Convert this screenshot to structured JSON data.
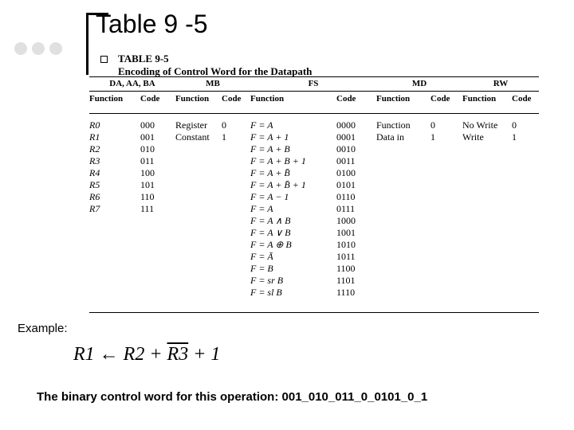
{
  "title": "Table 9 -5",
  "caption": {
    "num": "TABLE 9-5",
    "sub": "Encoding of Control Word for the Datapath"
  },
  "groups": {
    "da": "DA, AA, BA",
    "mb": "MB",
    "fs": "FS",
    "md": "MD",
    "rw": "RW"
  },
  "subheads": {
    "fn": "Function",
    "code": "Code"
  },
  "rows": {
    "da": [
      {
        "f": "R0",
        "c": "000"
      },
      {
        "f": "R1",
        "c": "001"
      },
      {
        "f": "R2",
        "c": "010"
      },
      {
        "f": "R3",
        "c": "011"
      },
      {
        "f": "R4",
        "c": "100"
      },
      {
        "f": "R5",
        "c": "101"
      },
      {
        "f": "R6",
        "c": "110"
      },
      {
        "f": "R7",
        "c": "111"
      }
    ],
    "mb": [
      {
        "f": "Register",
        "c": "0"
      },
      {
        "f": "Constant",
        "c": "1"
      }
    ],
    "fs": [
      {
        "f": "F = A",
        "c": "0000"
      },
      {
        "f": "F = A + 1",
        "c": "0001"
      },
      {
        "f": "F = A + B",
        "c": "0010"
      },
      {
        "f": "F = A + B + 1",
        "c": "0011"
      },
      {
        "f": "F = A + B̄",
        "c": "0100"
      },
      {
        "f": "F = A + B̄ + 1",
        "c": "0101"
      },
      {
        "f": "F = A − 1",
        "c": "0110"
      },
      {
        "f": "F = A",
        "c": "0111"
      },
      {
        "f": "F = A ∧ B",
        "c": "1000"
      },
      {
        "f": "F = A ∨ B",
        "c": "1001"
      },
      {
        "f": "F = A ⊕ B",
        "c": "1010"
      },
      {
        "f": "F = Ā",
        "c": "1011"
      },
      {
        "f": "F = B",
        "c": "1100"
      },
      {
        "f": "F = sr B",
        "c": "1101"
      },
      {
        "f": "F = sl B",
        "c": "1110"
      }
    ],
    "md": [
      {
        "f": "Function",
        "c": "0"
      },
      {
        "f": "Data in",
        "c": "1"
      }
    ],
    "rw": [
      {
        "f": "No Write",
        "c": "0"
      },
      {
        "f": "Write",
        "c": "1"
      }
    ]
  },
  "example_label": "Example:",
  "formula": {
    "lhs": "R1",
    "arrow": " ← ",
    "r2": "R2 + ",
    "r3": "R3",
    "tail": " + 1"
  },
  "bottom": "The binary control word for this operation: 001_010_011_0_0101_0_1"
}
